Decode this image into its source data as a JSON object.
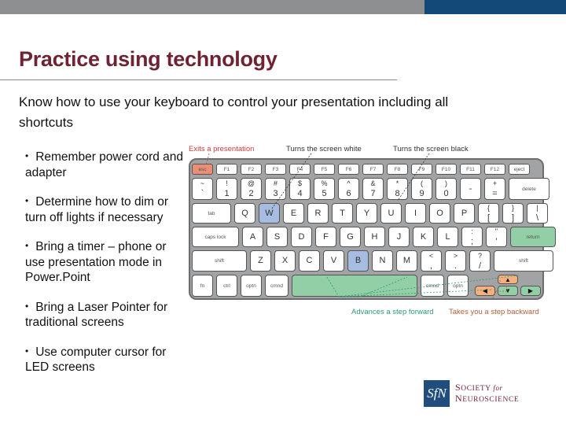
{
  "slide": {
    "title": "Practice using technology",
    "subtitle": "Know how to use your keyboard to control your presentation including all shortcuts",
    "bullets": [
      "Remember power cord and adapter",
      "Determine how to dim or turn off lights if necessary",
      "Bring a timer – phone or use presentation mode in Power.Point",
      "Bring a Laser Pointer for traditional screens",
      "Use computer cursor for LED screens"
    ],
    "bullet_glyph": "•"
  },
  "colors": {
    "title": "#6f2332",
    "topbar_gray": "#8e8f91",
    "topbar_blue": "#114a79",
    "key_exit": "#ec8e74",
    "key_white_black": "#a6bce0",
    "key_forward": "#93cfa6",
    "key_backward": "#f5b07e"
  },
  "keyboard": {
    "annotations": {
      "exit": "Exits a presentation",
      "white": "Turns the screen white",
      "black": "Turns the screen black",
      "forward": "Advances a step forward",
      "backward": "Takes you a step backward"
    },
    "fn_row": [
      "esc",
      "F1",
      "F2",
      "F3",
      "F4",
      "F5",
      "F6",
      "F7",
      "F8",
      "F9",
      "F10",
      "F11",
      "F12",
      "eject"
    ],
    "number_row": [
      {
        "top": "~",
        "bot": "`"
      },
      {
        "top": "!",
        "bot": "1"
      },
      {
        "top": "@",
        "bot": "2"
      },
      {
        "top": "#",
        "bot": "3"
      },
      {
        "top": "$",
        "bot": "4"
      },
      {
        "top": "%",
        "bot": "5"
      },
      {
        "top": "^",
        "bot": "6"
      },
      {
        "top": "&",
        "bot": "7"
      },
      {
        "top": "*",
        "bot": "8"
      },
      {
        "top": "(",
        "bot": "9"
      },
      {
        "top": ")",
        "bot": "0"
      },
      {
        "top": "",
        "bot": "-"
      },
      {
        "top": "+",
        "bot": "="
      },
      {
        "top": "",
        "bot": "delete"
      }
    ],
    "qwerty_row": [
      "tab",
      "Q",
      "W",
      "E",
      "R",
      "T",
      "Y",
      "U",
      "I",
      "O",
      "P",
      "{ [",
      "} ]",
      "| \\"
    ],
    "home_row": [
      "caps lock",
      "A",
      "S",
      "D",
      "F",
      "G",
      "H",
      "J",
      "K",
      "L",
      ": ;",
      "\" '",
      "return"
    ],
    "shift_row": [
      "shift",
      "Z",
      "X",
      "C",
      "V",
      "B",
      "N",
      "M",
      "< ,",
      "> .",
      "? /",
      "shift"
    ],
    "bottom_row": [
      "fn",
      "ctrl",
      "optn",
      "cmnd",
      "",
      "cmnd",
      "optn"
    ],
    "arrows": {
      "up": "▲",
      "left": "◀",
      "down": "▼",
      "right": "▶"
    }
  },
  "logo": {
    "mark": "SfN",
    "line1_big": "S",
    "line1_rest": "OCIETY",
    "line1_for": "for",
    "line2_big": "N",
    "line2_rest": "EUROSCIENCE"
  }
}
